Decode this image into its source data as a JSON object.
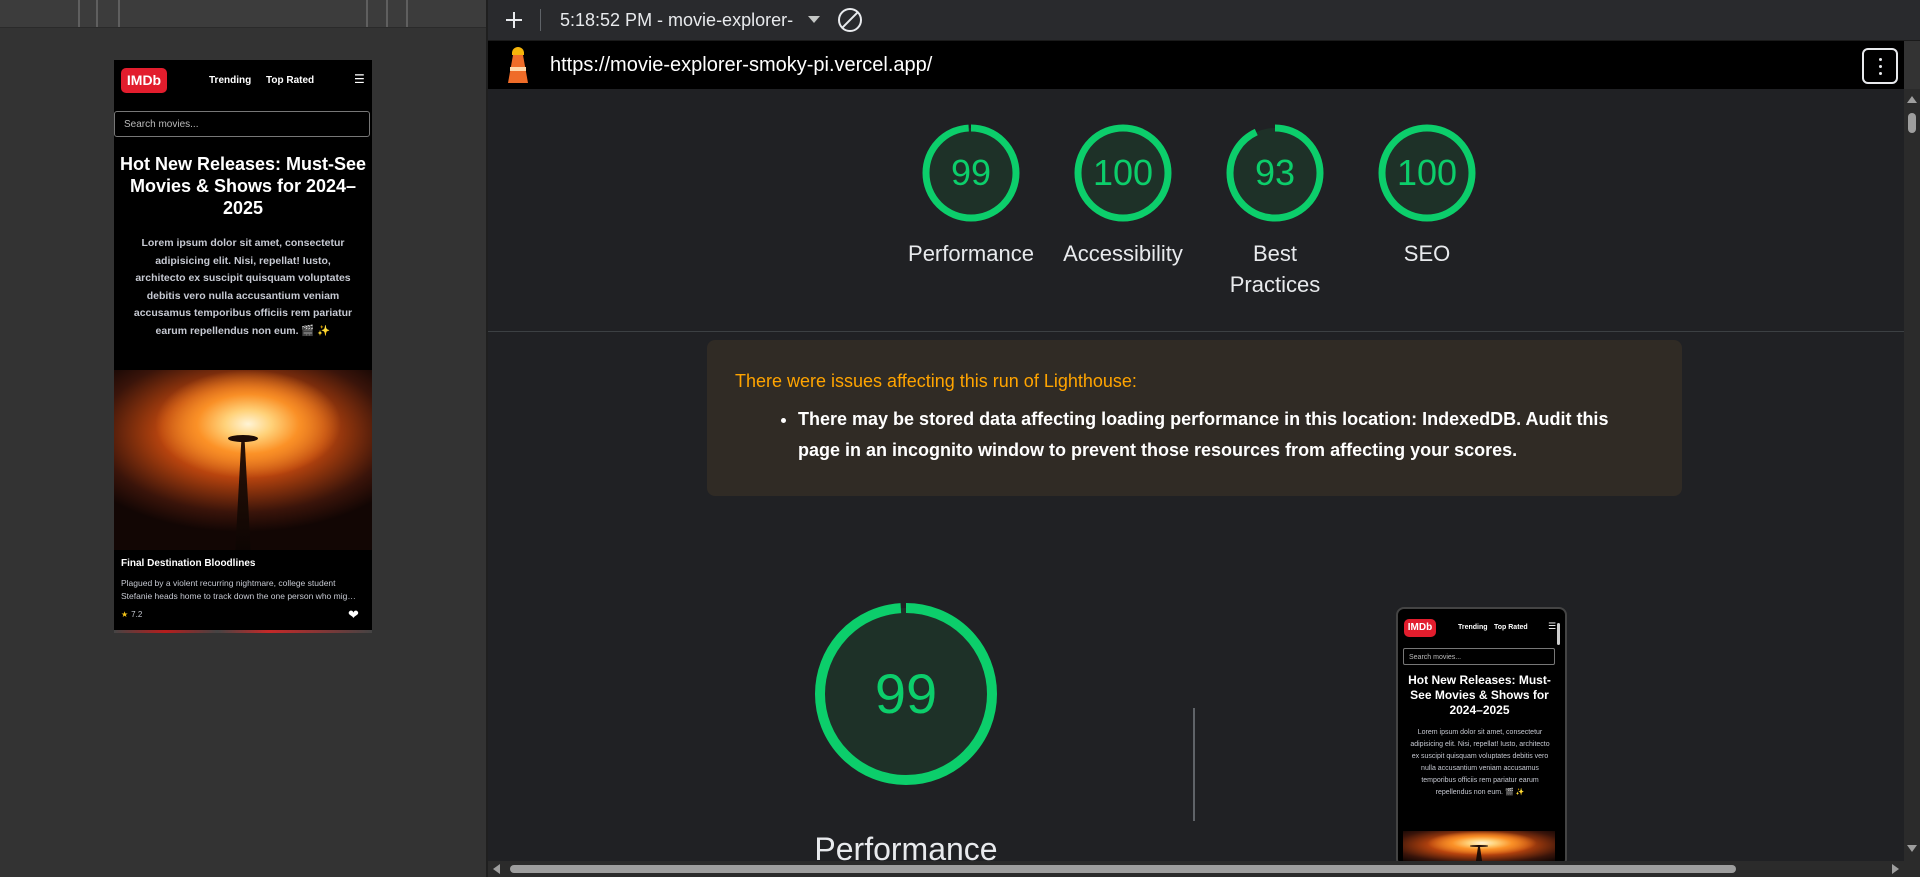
{
  "toolbar": {
    "report_title": "5:18:52 PM - movie-explorer-",
    "new_icon": "plus-icon",
    "clear_icon": "block-icon"
  },
  "url": "https://movie-explorer-smoky-pi.vercel.app/",
  "scores": [
    {
      "value": 99,
      "label": "Performance"
    },
    {
      "value": 100,
      "label": "Accessibility"
    },
    {
      "value": 93,
      "label": "Best Practices"
    },
    {
      "value": 100,
      "label": "SEO"
    }
  ],
  "warning": {
    "title": "There were issues affecting this run of Lighthouse:",
    "items": [
      "There may be stored data affecting loading performance in this location: IndexedDB. Audit this page in an incognito window to prevent those resources from affecting your scores."
    ]
  },
  "detail": {
    "score": 99,
    "label": "Performance"
  },
  "site": {
    "logo": "IMDb",
    "nav": [
      "Trending",
      "Top Rated"
    ],
    "menu_glyph": "☰",
    "search_placeholder": "Search movies...",
    "hero_title": "Hot New Releases: Must-See Movies & Shows for 2024–2025",
    "hero_desc": "Lorem ipsum dolor sit amet, consectetur adipisicing elit. Nisi, repellat! Iusto, architecto ex suscipit quisquam voluptates debitis vero nulla accusantium veniam accusamus temporibus officiis rem pariatur earum repellendus non eum. 🎬 ✨",
    "card": {
      "title": "Final Destination Bloodlines",
      "desc": "Plagued by a violent recurring nightmare, college student Stefanie heads home to track down the one person who mig…",
      "rating": "7.2",
      "star": "★",
      "heart": "❤"
    }
  },
  "colors": {
    "score_green": "#0cce6b",
    "score_green_bg": "#1e3128",
    "warning_orange": "#ffa400",
    "imdb_red": "#e21d2d"
  }
}
